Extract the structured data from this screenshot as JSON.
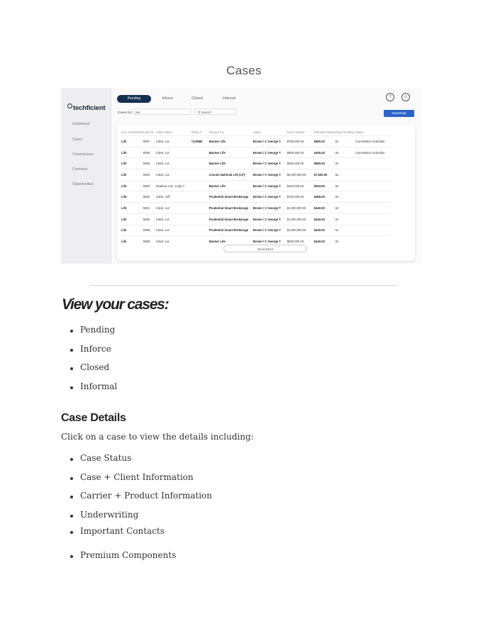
{
  "page_title": "Cases",
  "app": {
    "logo": "techficient",
    "sidebar": [
      "Dashboard",
      "Cases",
      "Commissions",
      "Contracts",
      "Opportunities"
    ],
    "tabs": [
      {
        "label": "Pending",
        "active": true
      },
      {
        "label": "Inforce",
        "active": false
      },
      {
        "label": "Closed",
        "active": false
      },
      {
        "label": "Informal",
        "active": false
      }
    ],
    "icons": {
      "help": "?",
      "account": "☺"
    },
    "cases_for_label": "Cases for:",
    "cases_for_value": "Me",
    "search_placeholder": "Search..",
    "download_label": "Download",
    "table": {
      "headers": [
        "Line of Business",
        "Case ID",
        "Client Name",
        "Policy #",
        "Insured Co.",
        "Agent",
        "Face Amount",
        "Premium Target",
        "Days Pending",
        "Status"
      ],
      "rows": [
        [
          "Life",
          "5097",
          "Client, Lor",
          "*123980",
          "Banner Life",
          "Brown \\ C George T",
          "$750,000.00",
          "$690.00",
          "61",
          "Commission Schedule"
        ],
        [
          "Life",
          "5096",
          "Client, Lor",
          "",
          "Banner Life",
          "Brown \\ C George T",
          "$500,000.00",
          "$409.40",
          "64",
          "Commission Schedule"
        ],
        [
          "Life",
          "5095",
          "Client, Lor",
          "",
          "Banner Life",
          "Brown \\ C George T",
          "$500,000.00",
          "$990.00",
          "61",
          ""
        ],
        [
          "Life",
          "5094",
          "Client, Lor",
          "",
          "Lincoln National Life (LP)",
          "Brown \\ C George T",
          "$2,000,000.00",
          "$7,500.00",
          "64",
          ""
        ],
        [
          "Life",
          "5093",
          "Realtner A.B., Cody T.",
          "",
          "Banner Life",
          "Brown \\ C George T",
          "$400,000.00",
          "$504.00",
          "64",
          ""
        ],
        [
          "Life",
          "5092",
          "Client, Jeff",
          "",
          "Prudential Smart Brokerage",
          "Brown \\ C George T",
          "$750,000.00",
          "$465.00",
          "64",
          ""
        ],
        [
          "Life",
          "5091",
          "Client, Lor",
          "",
          "Prudential Smart Brokerage",
          "Brown \\ C George T",
          "$1,000,000.00",
          "$440.00",
          "64",
          ""
        ],
        [
          "Life",
          "5090",
          "Client, Lor",
          "",
          "Prudential Smart Brokerage",
          "Brown \\ C George T",
          "$1,000,000.00",
          "$440.00",
          "61",
          ""
        ],
        [
          "Life",
          "5089",
          "Client, Lor",
          "",
          "Prudential Smart Brokerage",
          "Brown \\ C George T",
          "$1,000,000.00",
          "$440.00",
          "61",
          ""
        ],
        [
          "Life",
          "5088",
          "Client, Lor",
          "",
          "Banner Life",
          "Brown \\ C George T",
          "$500,000.00",
          "$440.00",
          "61",
          ""
        ]
      ]
    },
    "show_more_label": "Show More"
  },
  "view_heading": "View your cases:",
  "view_items": [
    "Pending",
    "Inforce",
    "Closed",
    "Informal"
  ],
  "details_heading": "Case Details",
  "details_intro": "Click on a case to view the details including:",
  "details_items": [
    "Case Status",
    "Case + Client Information",
    "Carrier + Product Information",
    "Underwriting",
    "Important Contacts",
    "Premium Components"
  ]
}
